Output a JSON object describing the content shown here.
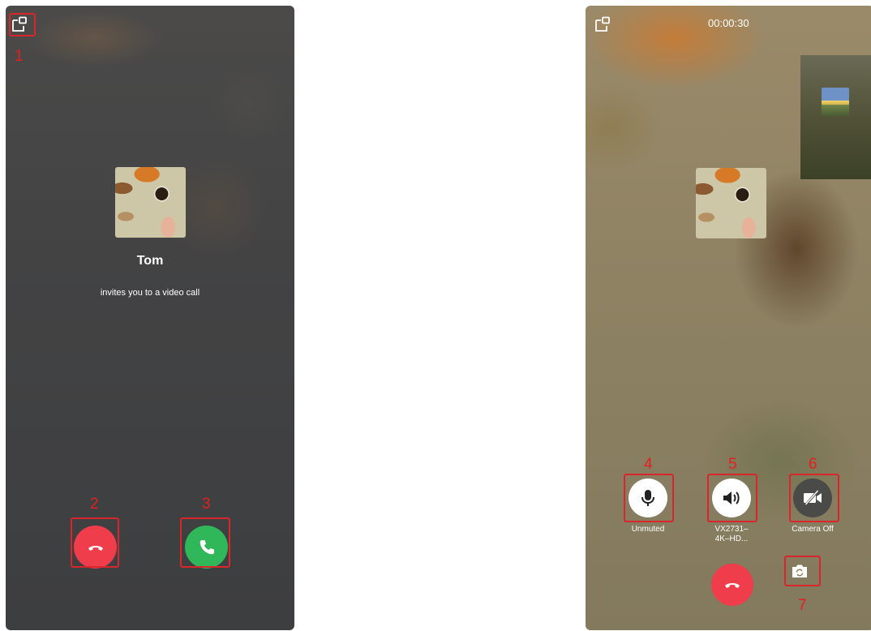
{
  "left_screen": {
    "caller_name": "Tom",
    "invite_text": "invites you to a video call"
  },
  "right_screen": {
    "call_timer": "00:00:30",
    "mic_label": "Unmuted",
    "speaker_label_line1": "VX2731–",
    "speaker_label_line2": "4K–HD...",
    "camera_label": "Camera Off"
  },
  "annotations": [
    "1",
    "2",
    "3",
    "4",
    "5",
    "6",
    "7"
  ],
  "colors": {
    "reject_red": "#ef3d4b",
    "accept_green": "#2fb75a",
    "annotation_red": "#d8262a"
  },
  "icons": {
    "minimize": "minimize-window-icon",
    "hangup": "phone-hangup-icon",
    "accept": "phone-accept-icon",
    "mic": "microphone-icon",
    "speaker": "speaker-icon",
    "camera_off": "camera-off-icon",
    "switch_camera": "switch-camera-icon"
  }
}
